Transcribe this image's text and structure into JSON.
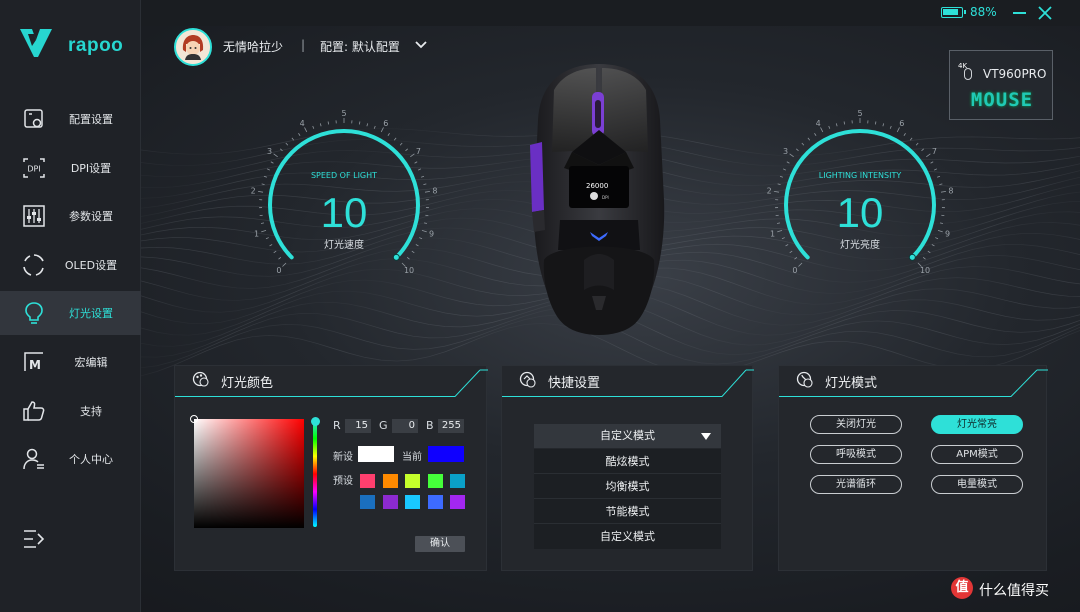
{
  "app": {
    "brand": "rapoo",
    "accent": "#2ee0d8"
  },
  "topbar": {
    "battery_percent": 88,
    "battery_text": "88%"
  },
  "profile": {
    "username": "无情哈拉少",
    "separator": "|",
    "config_label": "配置: 默认配置"
  },
  "device": {
    "badge_4k": "4K",
    "model": "VT960PRO",
    "type_label": "MOUSE"
  },
  "sidebar": {
    "items": [
      {
        "label": "配置设置",
        "icon": "config-icon"
      },
      {
        "label": "DPI设置",
        "icon": "dpi-icon"
      },
      {
        "label": "参数设置",
        "icon": "sliders-icon"
      },
      {
        "label": "OLED设置",
        "icon": "oled-icon"
      },
      {
        "label": "灯光设置",
        "icon": "bulb-icon",
        "active": true
      },
      {
        "label": "宏编辑",
        "icon": "macro-icon"
      },
      {
        "label": "支持",
        "icon": "thumbs-up-icon"
      },
      {
        "label": "个人中心",
        "icon": "user-icon"
      }
    ]
  },
  "gauges": {
    "speed": {
      "title": "SPEED OF LIGHT",
      "value": "10",
      "level": 10,
      "subtitle": "灯光速度",
      "ticks": [
        "0",
        "1",
        "2",
        "3",
        "4",
        "5",
        "6",
        "7",
        "8",
        "9",
        "10"
      ]
    },
    "intensity": {
      "title": "LIGHTING INTENSITY",
      "value": "10",
      "level": 10,
      "subtitle": "灯光亮度",
      "ticks": [
        "0",
        "1",
        "2",
        "3",
        "4",
        "5",
        "6",
        "7",
        "8",
        "9",
        "10"
      ]
    }
  },
  "mouse_screen": {
    "dpi_text": "26000",
    "dpi_unit": "DPI"
  },
  "color_panel": {
    "title": "灯光颜色",
    "r_label": "R",
    "r_value": "15",
    "g_label": "G",
    "g_value": "0",
    "b_label": "B",
    "b_value": "255",
    "new_label": "新设",
    "current_label": "当前",
    "new_color": "#ffffff",
    "current_color": "#0f00ff",
    "preset_label": "预设",
    "presets": [
      "#ff3f6e",
      "#ff8a00",
      "#c5ff2b",
      "#45ff3a",
      "#0aa0c8",
      "#1a6fbe",
      "#8c2ad0",
      "#19c8ff",
      "#3d6bff",
      "#a327f0"
    ],
    "confirm_label": "确认"
  },
  "quick_panel": {
    "title": "快捷设置",
    "selected": "自定义模式",
    "options": [
      "酷炫模式",
      "均衡模式",
      "节能模式",
      "自定义模式"
    ]
  },
  "mode_panel": {
    "title": "灯光模式",
    "modes": [
      {
        "label": "关闭灯光",
        "active": false
      },
      {
        "label": "灯光常亮",
        "active": true
      },
      {
        "label": "呼吸模式",
        "active": false
      },
      {
        "label": "APM模式",
        "active": false
      },
      {
        "label": "光谱循环",
        "active": false
      },
      {
        "label": "电量模式",
        "active": false
      }
    ]
  },
  "watermark": {
    "badge": "值",
    "text": "什么值得买"
  }
}
